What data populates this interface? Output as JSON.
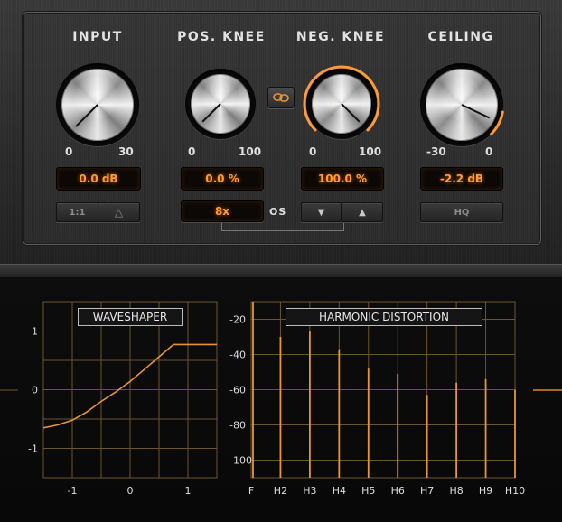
{
  "controls": {
    "input": {
      "title": "INPUT",
      "min": "0",
      "max": "30",
      "readout": "0.0 dB",
      "value_fraction": 0.0
    },
    "pos_knee": {
      "title": "POS. KNEE",
      "min": "0",
      "max": "100",
      "readout": "0.0 %",
      "value_fraction": 0.0
    },
    "neg_knee": {
      "title": "NEG. KNEE",
      "min": "0",
      "max": "100",
      "readout": "100.0 %",
      "value_fraction": 1.0
    },
    "ceiling": {
      "title": "CEILING",
      "min": "-30",
      "max": "0",
      "readout": "-2.2 dB",
      "value_fraction": 0.927
    }
  },
  "buttons": {
    "ratio_label": "1:1",
    "delta_label": "△",
    "os_value": "8x",
    "os_label": "OS",
    "down_label": "▼",
    "up_label": "▲",
    "hq_label": "HQ"
  },
  "icons": {
    "link": "link-icon"
  },
  "colors": {
    "accent": "#ff9a3a",
    "curve": "#e8953a",
    "grid": "#6b5530"
  },
  "waveshaper": {
    "title": "WAVESHAPER",
    "x_ticks": [
      "-1",
      "0",
      "1"
    ],
    "y_ticks": [
      "1",
      "0",
      "-1"
    ]
  },
  "harmonics": {
    "title": "HARMONIC DISTORTION",
    "y_ticks": [
      "-20",
      "-40",
      "-60",
      "-80",
      "-100"
    ],
    "x_labels": [
      "F",
      "H2",
      "H3",
      "H4",
      "H5",
      "H6",
      "H7",
      "H8",
      "H9",
      "H10"
    ]
  },
  "chart_data": [
    {
      "type": "line",
      "title": "WAVESHAPER",
      "xlim": [
        -1.5,
        1.5
      ],
      "ylim": [
        -1.5,
        1.5
      ],
      "x": [
        -1.5,
        -1.25,
        -1.0,
        -0.75,
        -0.5,
        -0.25,
        0.0,
        0.25,
        0.5,
        0.75,
        1.0,
        1.25,
        1.5
      ],
      "values": [
        -0.65,
        -0.6,
        -0.52,
        -0.38,
        -0.2,
        -0.04,
        0.14,
        0.35,
        0.56,
        0.77,
        0.77,
        0.77,
        0.77
      ],
      "grid": true
    },
    {
      "type": "bar",
      "title": "HARMONIC DISTORTION",
      "categories": [
        "F",
        "H2",
        "H3",
        "H4",
        "H5",
        "H6",
        "H7",
        "H8",
        "H9",
        "H10"
      ],
      "values": [
        -10,
        -30,
        -27,
        -37,
        -48,
        -51,
        -63,
        -56,
        -54,
        -60
      ],
      "ylim": [
        -110,
        -10
      ],
      "grid": true
    }
  ]
}
